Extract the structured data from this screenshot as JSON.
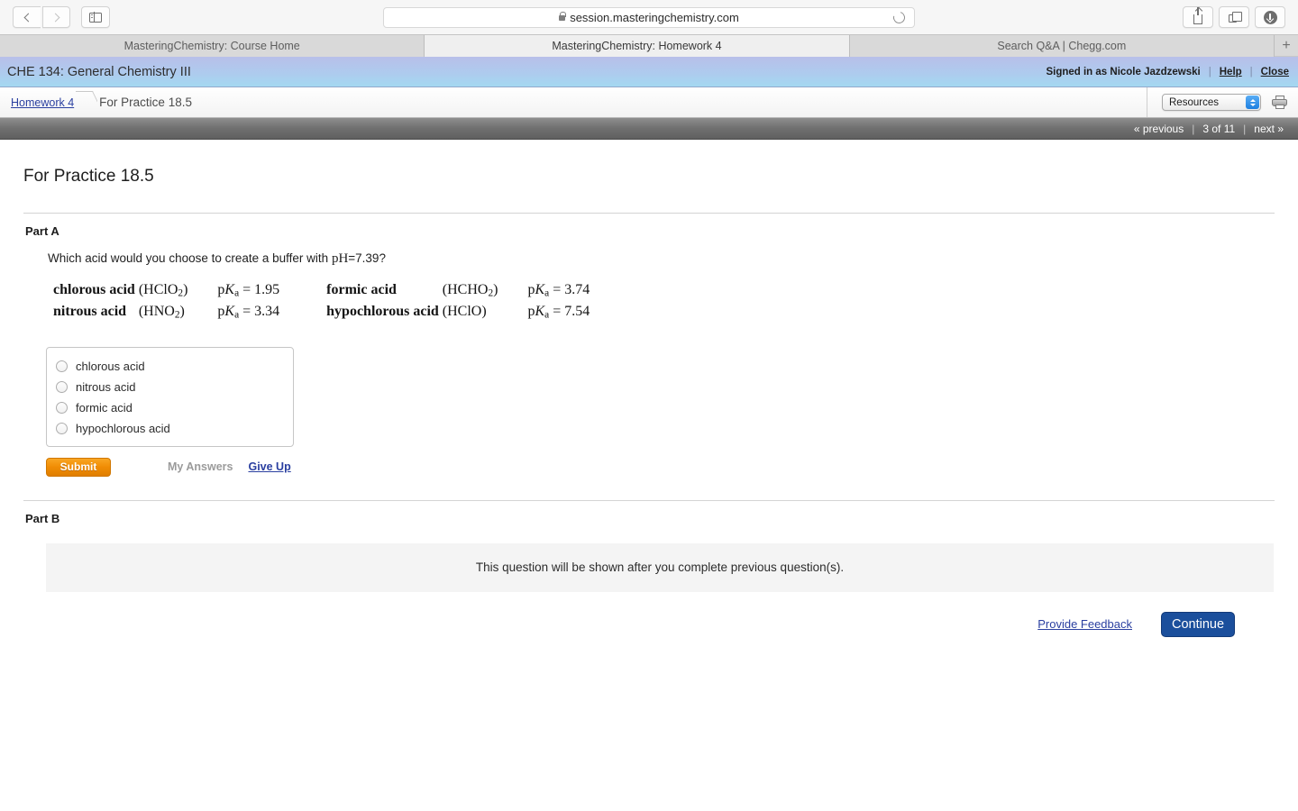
{
  "browser": {
    "url": "session.masteringchemistry.com",
    "back_icon": "chevron-left-icon",
    "forward_icon": "chevron-right-icon",
    "sidebar_icon": "sidebar-toggle-icon",
    "lock_icon": "lock-icon",
    "reload_icon": "reload-icon",
    "share_icon": "share-icon",
    "tabs_icon": "tab-overview-icon",
    "download_icon": "download-icon",
    "new_tab_label": "+",
    "tabs": [
      {
        "label": "MasteringChemistry: Course Home",
        "active": false
      },
      {
        "label": "MasteringChemistry: Homework 4",
        "active": true
      },
      {
        "label": "Search Q&A | Chegg.com",
        "active": false
      }
    ]
  },
  "mc_header": {
    "course_title": "CHE 134: General Chemistry III",
    "signed_in_as": "Signed in as Nicole Jazdzewski",
    "separator": "|",
    "help_label": "Help",
    "close_label": "Close"
  },
  "breadcrumb": {
    "parent_label": "Homework 4",
    "current_label": "For Practice 18.5",
    "resources_select": "Resources",
    "print_icon": "printer-icon"
  },
  "pager": {
    "previous_label": "« previous",
    "separator": "|",
    "position_label": "3 of 11",
    "next_label": "next »"
  },
  "question": {
    "title": "For Practice 18.5",
    "part_a_label": "Part A",
    "prompt_before": "Which acid would you choose to create a buffer with ",
    "prompt_math": "pH",
    "prompt_after": "=7.39?",
    "acids": [
      {
        "name": "chlorous acid",
        "formula_open": "(HClO",
        "formula_sub": "2",
        "formula_close": ")",
        "pka_label": "p",
        "pka_k": "K",
        "pka_sub": "a",
        "pka_eq": "= 1.95"
      },
      {
        "name": "nitrous acid",
        "formula_open": "(HNO",
        "formula_sub": "2",
        "formula_close": ")",
        "pka_label": "p",
        "pka_k": "K",
        "pka_sub": "a",
        "pka_eq": "= 3.34"
      },
      {
        "name": "formic acid",
        "formula_open": "(HCHO",
        "formula_sub": "2",
        "formula_close": ")",
        "pka_label": "p",
        "pka_k": "K",
        "pka_sub": "a",
        "pka_eq": "= 3.74"
      },
      {
        "name": "hypochlorous acid",
        "formula_open": "(HClO",
        "formula_sub": "",
        "formula_close": ")",
        "pka_label": "p",
        "pka_k": "K",
        "pka_sub": "a",
        "pka_eq": "= 7.54"
      }
    ],
    "options": [
      {
        "label": "chlorous acid",
        "selected": false
      },
      {
        "label": "nitrous acid",
        "selected": false
      },
      {
        "label": "formic acid",
        "selected": false
      },
      {
        "label": "hypochlorous acid",
        "selected": false
      }
    ],
    "submit_label": "Submit",
    "my_answers_label": "My Answers",
    "give_up_label": "Give Up",
    "part_b_label": "Part B",
    "part_b_locked_message": "This question will be shown after you complete previous question(s)."
  },
  "footer": {
    "feedback_label": "Provide Feedback",
    "continue_label": "Continue"
  },
  "colors": {
    "submit_orange": "#f08c04",
    "continue_blue": "#1b4f9c",
    "link_blue": "#2a3fa0",
    "header_gradient_top": "#b8bfe9",
    "header_gradient_bottom": "#a4d8f1"
  }
}
